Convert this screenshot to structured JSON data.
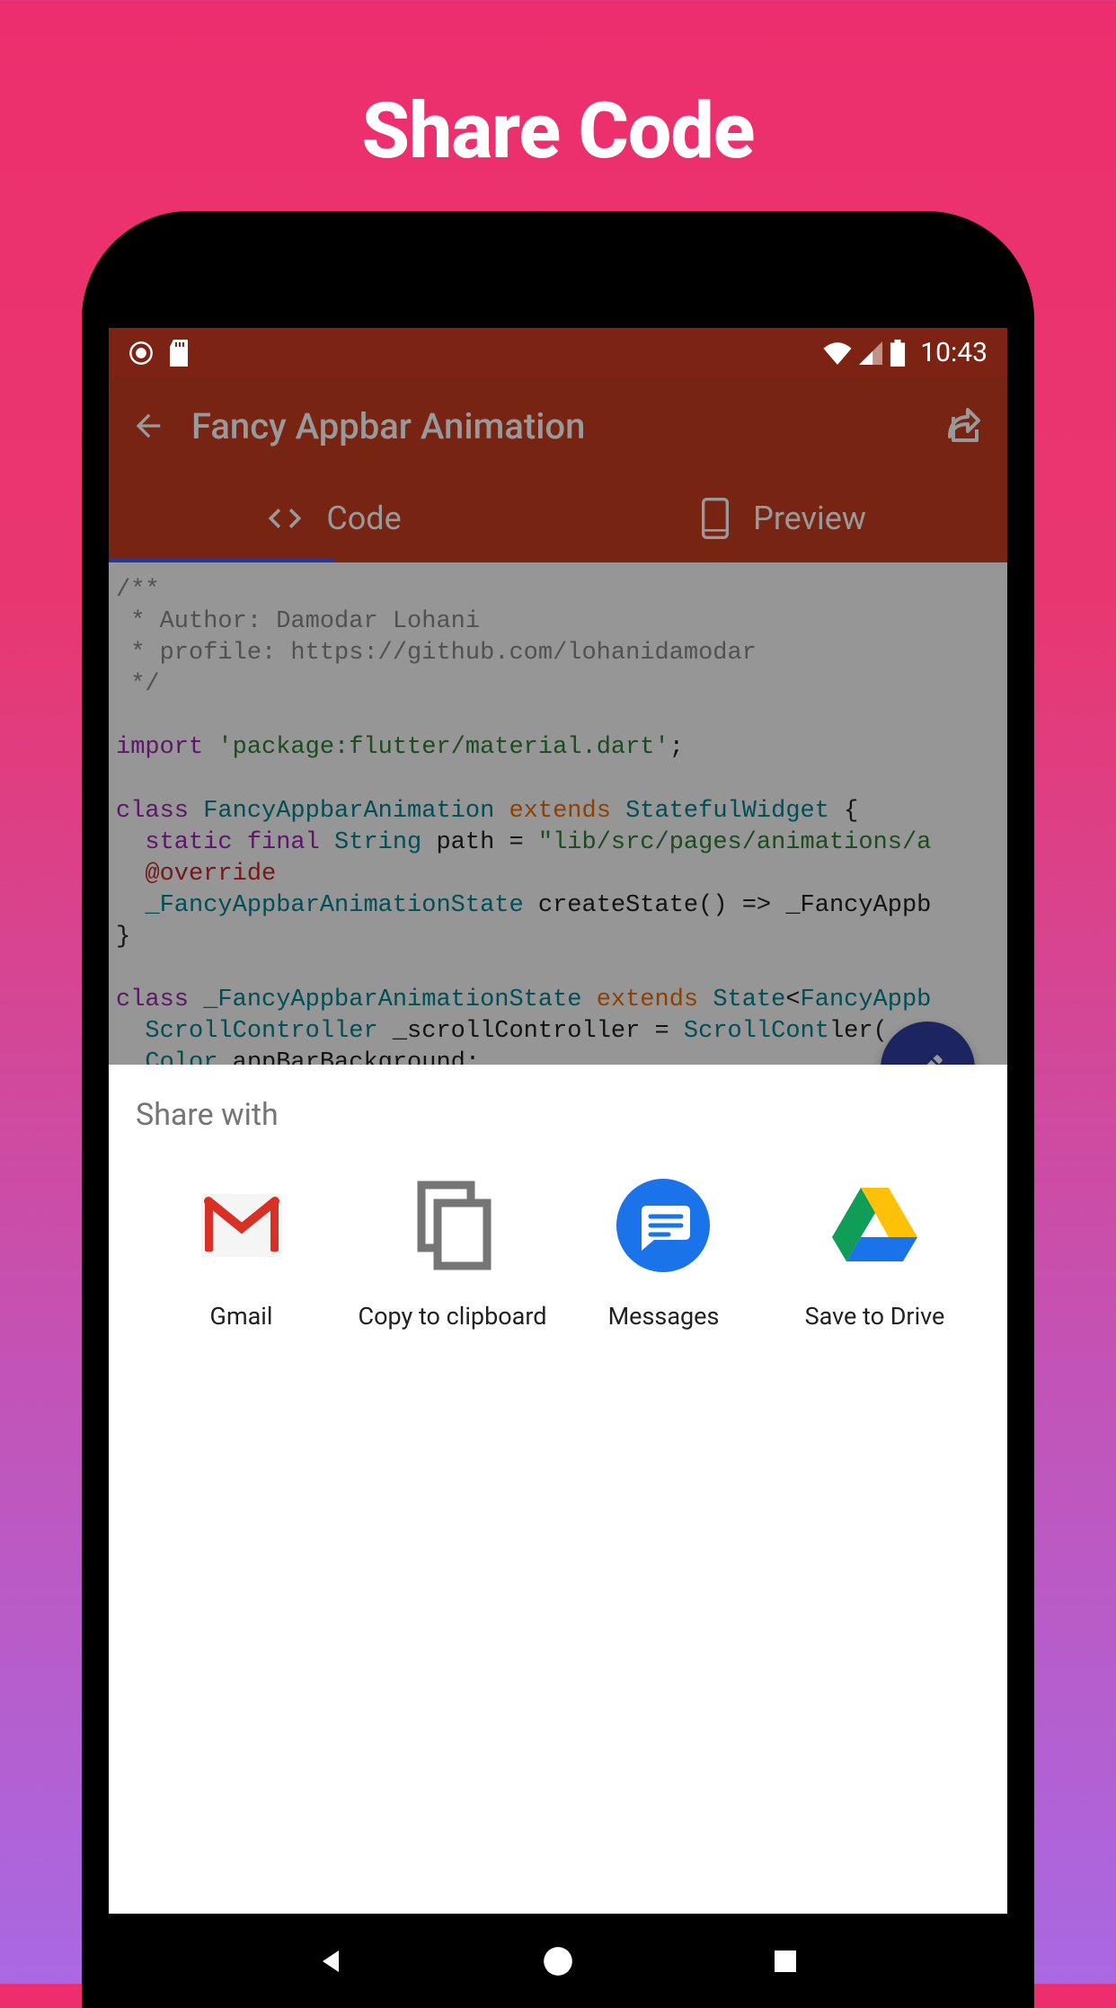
{
  "promo": {
    "title": "Share Code"
  },
  "statusBar": {
    "time": "10:43"
  },
  "appBar": {
    "title": "Fancy Appbar Animation"
  },
  "tabs": {
    "code": "Code",
    "preview": "Preview"
  },
  "code": {
    "comment1": "/**",
    "comment2": " * Author: Damodar Lohani",
    "comment3": " * profile: https://github.com/lohanidamodar",
    "comment4": " */",
    "import": "import",
    "importPath": "'package:flutter/material.dart'",
    "semicolon": ";",
    "class": "class",
    "className1": "FancyAppbarAnimation",
    "extends": "extends",
    "extendsName": "StatefulWidget",
    "brace": " {",
    "static": "static",
    "final": "final",
    "string": "String",
    "path": " path = ",
    "pathValue": "\"lib/src/pages/animations/a",
    "override": "@override",
    "stateClass": "_FancyAppbarAnimationState",
    "createState": " createState() => _FancyAppb",
    "closeBrace": "}",
    "className2": "_FancyAppbarAnimationState",
    "stateGeneric": "State",
    "lt": "<",
    "fancyAppb": "FancyAppb",
    "scrollController": "ScrollController",
    "scrollVar": " _scrollController = ",
    "scrollCont": "ScrollCont",
    "ler": "ler(",
    "color": "Color",
    "appBarBg": " appBarBackground;"
  },
  "shareSheet": {
    "title": "Share with",
    "items": [
      {
        "label": "Gmail"
      },
      {
        "label": "Copy to clipboard"
      },
      {
        "label": "Messages"
      },
      {
        "label": "Save to Drive"
      }
    ]
  }
}
